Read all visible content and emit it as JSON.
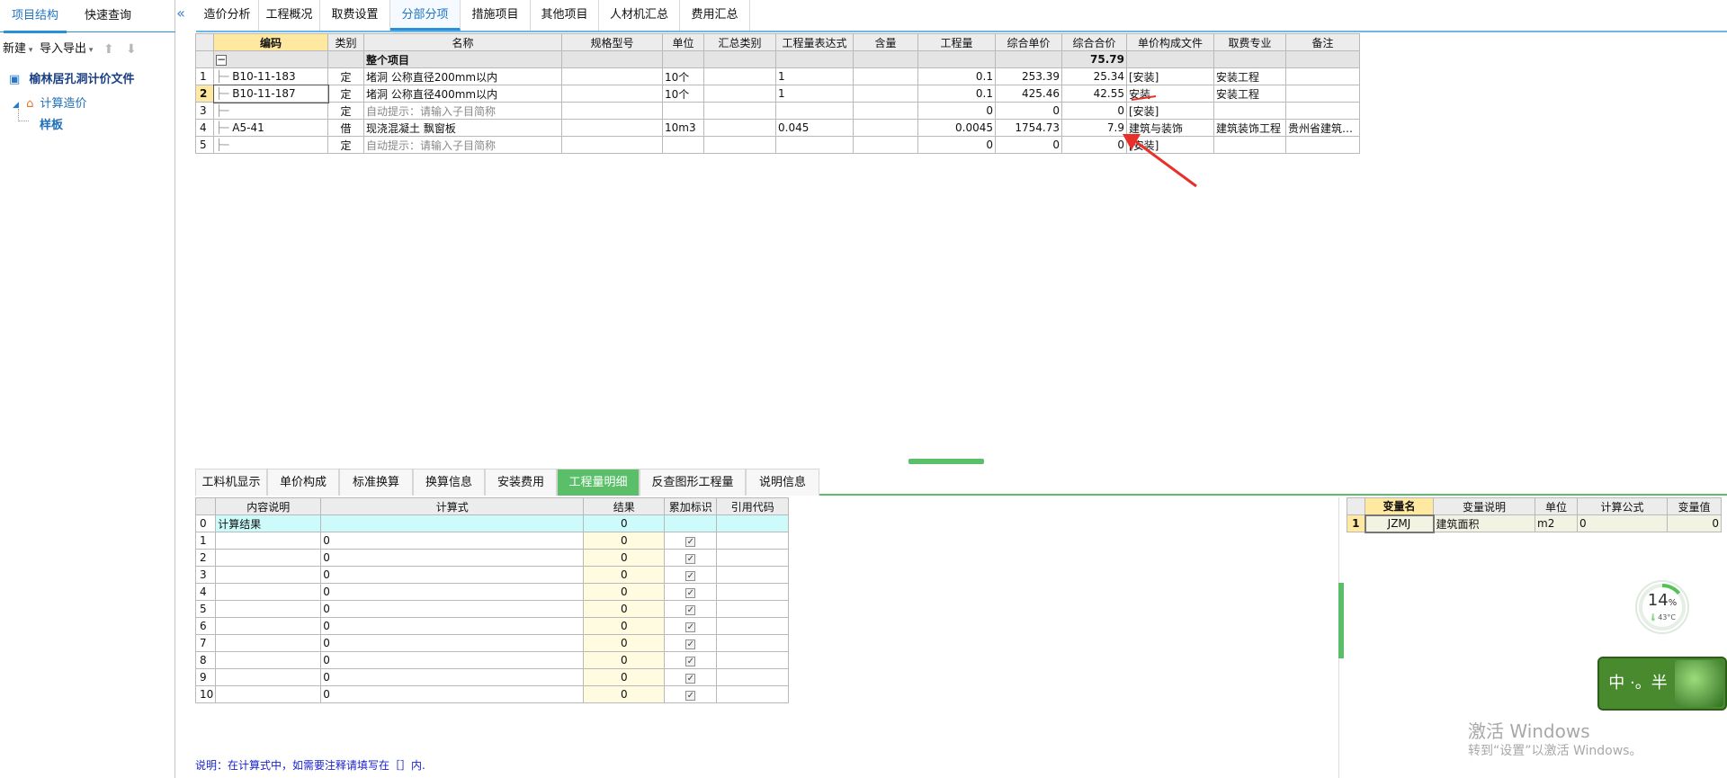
{
  "left": {
    "tabs": [
      {
        "label": "项目结构",
        "active": true
      },
      {
        "label": "快速查询",
        "active": false
      }
    ],
    "collapse_icon": "«",
    "toolbar": {
      "new": "新建",
      "import_export": "导入导出"
    },
    "tree": {
      "root": "榆林居孔洞计价文件",
      "child": "计算造价",
      "leaf": "样板"
    }
  },
  "top_tabs": [
    "造价分析",
    "工程概况",
    "取费设置",
    "分部分项",
    "措施项目",
    "其他项目",
    "人材机汇总",
    "费用汇总"
  ],
  "top_tab_active": "分部分项",
  "main_table": {
    "headers": [
      "编码",
      "类别",
      "名称",
      "规格型号",
      "单位",
      "汇总类别",
      "工程量表达式",
      "含量",
      "工程量",
      "综合单价",
      "综合合价",
      "单价构成文件",
      "取费专业",
      "备注"
    ],
    "summary": {
      "collapse": "−",
      "name": "整个项目",
      "total": "75.79"
    },
    "rows": [
      {
        "idx": "1",
        "code": "B10-11-183",
        "type": "定",
        "name": "堵洞 公称直径200mm以内",
        "spec": "",
        "unit": "10个",
        "sumtype": "",
        "expr": "1",
        "content": "",
        "qty": "0.1",
        "price": "253.39",
        "total": "25.34",
        "file": "[安装]",
        "major": "安装工程",
        "remark": "",
        "nameGrey": false
      },
      {
        "idx": "2",
        "code": "B10-11-187",
        "type": "定",
        "name": "堵洞 公称直径400mm以内",
        "spec": "",
        "unit": "10个",
        "sumtype": "",
        "expr": "1",
        "content": "",
        "qty": "0.1",
        "price": "425.46",
        "total": "42.55",
        "file": "安装",
        "major": "安装工程",
        "remark": "",
        "nameGrey": false
      },
      {
        "idx": "3",
        "code": "",
        "type": "定",
        "name": "自动提示：请输入子目简称",
        "spec": "",
        "unit": "",
        "sumtype": "",
        "expr": "",
        "content": "",
        "qty": "0",
        "price": "0",
        "total": "0",
        "file": "[安装]",
        "major": "",
        "remark": "",
        "nameGrey": true
      },
      {
        "idx": "4",
        "code": "A5-41",
        "type": "借",
        "name": "现浇混凝土 飘窗板",
        "spec": "",
        "unit": "10m3",
        "sumtype": "",
        "expr": "0.045",
        "content": "",
        "qty": "0.0045",
        "price": "1754.73",
        "total": "7.9",
        "file": "建筑与装饰",
        "major": "建筑装饰工程",
        "remark": "贵州省建筑…",
        "nameGrey": false
      },
      {
        "idx": "5",
        "code": "",
        "type": "定",
        "name": "自动提示：请输入子目简称",
        "spec": "",
        "unit": "",
        "sumtype": "",
        "expr": "",
        "content": "",
        "qty": "0",
        "price": "0",
        "total": "0",
        "file": "[安装]",
        "major": "",
        "remark": "",
        "nameGrey": true
      }
    ]
  },
  "bottom_tabs": [
    "工料机显示",
    "单价构成",
    "标准换算",
    "换算信息",
    "安装费用",
    "工程量明细",
    "反查图形工程量",
    "说明信息"
  ],
  "bottom_tab_active": "工程量明细",
  "detail_table": {
    "headers": [
      "内容说明",
      "计算式",
      "结果",
      "累加标识",
      "引用代码"
    ],
    "first": {
      "idx": "0",
      "label": "计算结果",
      "result": "0"
    },
    "rows": [
      {
        "idx": "1",
        "expr": "0",
        "result": "0"
      },
      {
        "idx": "2",
        "expr": "0",
        "result": "0"
      },
      {
        "idx": "3",
        "expr": "0",
        "result": "0"
      },
      {
        "idx": "4",
        "expr": "0",
        "result": "0"
      },
      {
        "idx": "5",
        "expr": "0",
        "result": "0"
      },
      {
        "idx": "6",
        "expr": "0",
        "result": "0"
      },
      {
        "idx": "7",
        "expr": "0",
        "result": "0"
      },
      {
        "idx": "8",
        "expr": "0",
        "result": "0"
      },
      {
        "idx": "9",
        "expr": "0",
        "result": "0"
      },
      {
        "idx": "10",
        "expr": "0",
        "result": "0"
      }
    ]
  },
  "var_table": {
    "headers": [
      "变量名",
      "变量说明",
      "单位",
      "计算公式",
      "变量值"
    ],
    "rows": [
      {
        "idx": "1",
        "name": "JZMJ",
        "desc": "建筑面积",
        "unit": "m2",
        "formula": "0",
        "value": "0"
      }
    ]
  },
  "note": "说明：在计算式中，如需要注释请填写在［］内.",
  "cpu": {
    "percent": "14",
    "unit": "%",
    "temp": "43°C"
  },
  "ime": {
    "text": "中 ·。半"
  },
  "watermark": {
    "line1": "激活 Windows",
    "line2": "转到“设置”以激活 Windows。"
  },
  "colors": {
    "accent": "#2b8fd8",
    "green": "#5bbf6a",
    "headerHighlight": "#ffe8a0",
    "arrow": "#e8302a"
  }
}
